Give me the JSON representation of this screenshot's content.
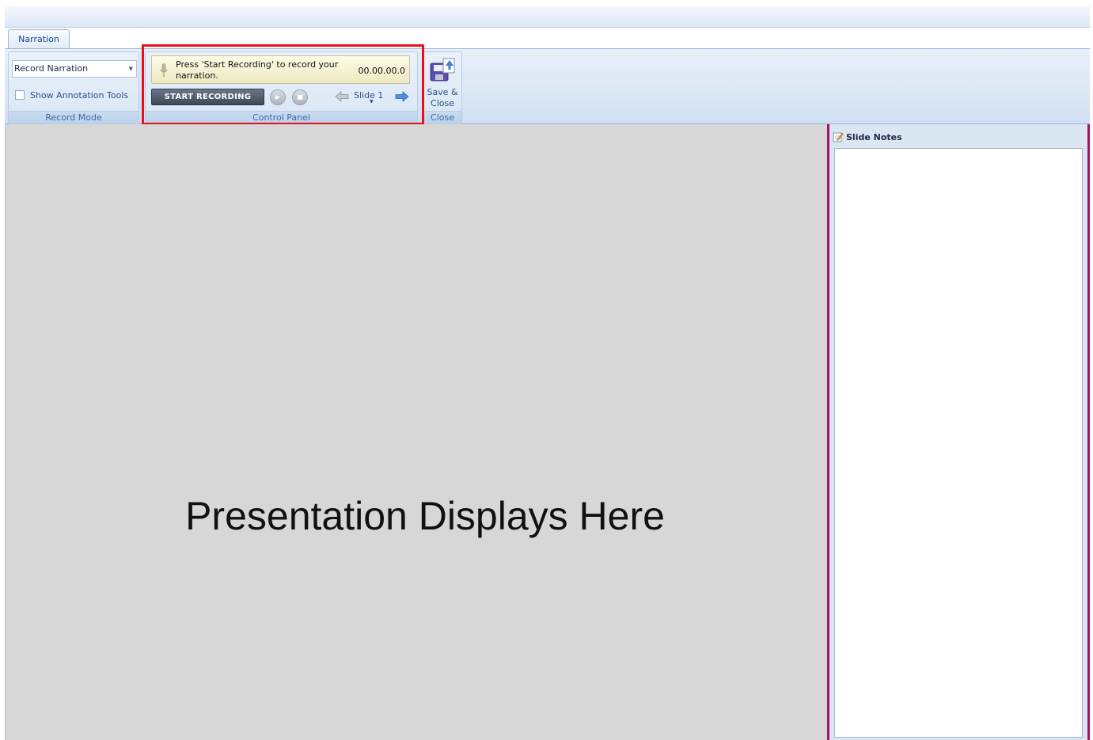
{
  "tabs": [
    {
      "label": "Narration"
    }
  ],
  "record_mode": {
    "selected": "Record Narration",
    "checkbox_label": "Show Annotation Tools",
    "group_label": "Record Mode"
  },
  "control_panel": {
    "message": "Press 'Start Recording' to record your narration.",
    "timer": "00.00.00.0",
    "record_button": "START RECORDING",
    "slide": "Slide 1",
    "group_label": "Control Panel"
  },
  "close_group": {
    "save_close_label": "Save & Close",
    "group_label": "Close"
  },
  "stage": {
    "placeholder": "Presentation Displays Here"
  },
  "notes": {
    "title": "Slide Notes"
  },
  "colors": {
    "highlight": "#e8101a",
    "notes_border": "#a8136a",
    "stage_bg": "#d7d7d7"
  }
}
